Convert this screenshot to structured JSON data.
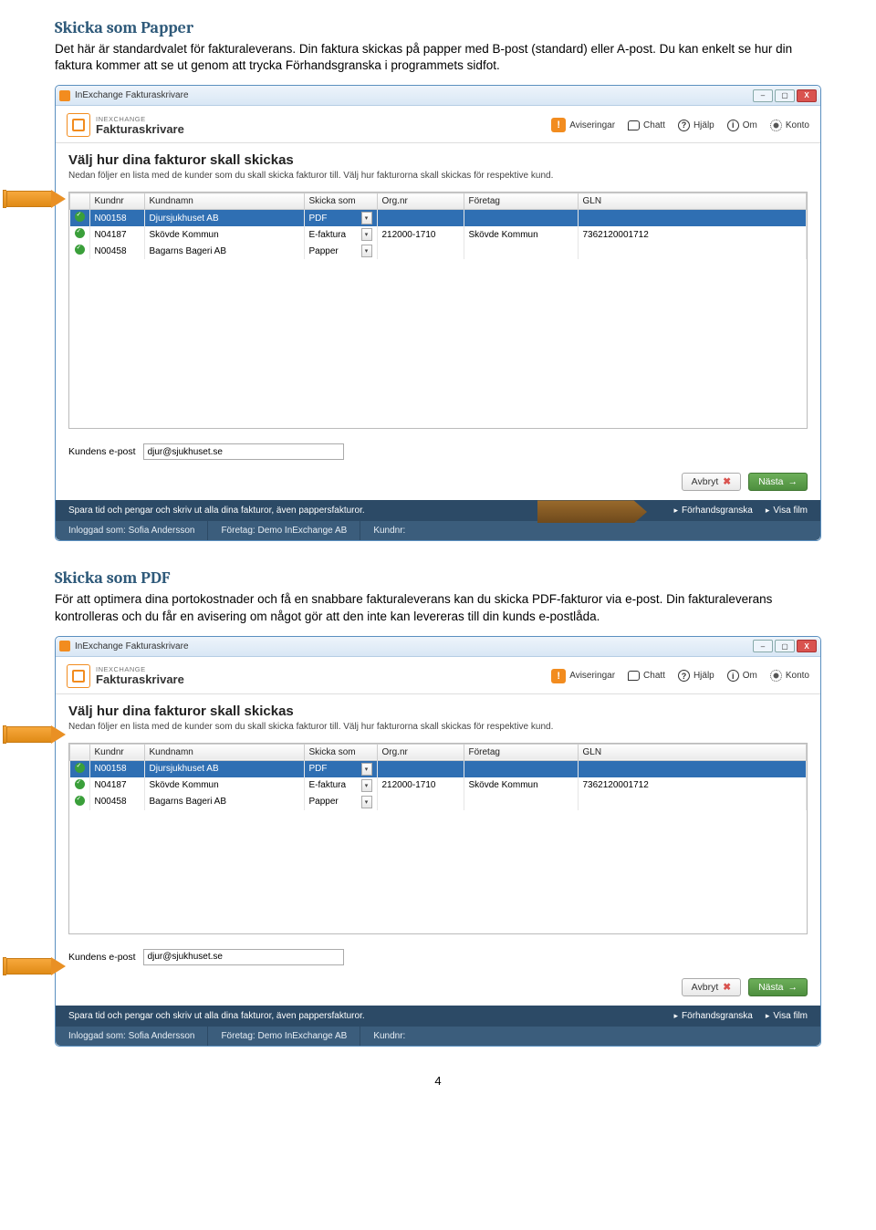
{
  "doc": {
    "page_number": "4",
    "section1": {
      "heading": "Skicka som Papper",
      "text": "Det här är standardvalet för fakturaleverans. Din faktura skickas på papper med B-post (standard) eller A-post. Du kan enkelt se hur din faktura kommer att se ut genom att trycka Förhandsgranska i programmets sidfot."
    },
    "section2": {
      "heading": "Skicka som PDF",
      "text": "För att optimera dina portokostnader och få en snabbare fakturaleverans kan du skicka PDF-fakturor via e-post. Din fakturaleverans kontrolleras och du får en avisering om något gör att den inte kan levereras till din kunds e-postlåda."
    }
  },
  "app": {
    "window_title": "InExchange Fakturaskrivare",
    "brand_small": "INEXCHANGE",
    "brand_big": "Fakturaskrivare",
    "toplinks": {
      "aviseringar": "Aviseringar",
      "chatt": "Chatt",
      "hjalp": "Hjälp",
      "om": "Om",
      "konto": "Konto"
    },
    "page_title": "Välj hur dina fakturor skall skickas",
    "page_sub": "Nedan följer en lista med de kunder som du skall skicka fakturor till. Välj hur fakturorna skall skickas för respektive kund.",
    "columns": {
      "kundnr": "Kundnr",
      "kundnamn": "Kundnamn",
      "skicka": "Skicka som",
      "org": "Org.nr",
      "foretag": "Företag",
      "gln": "GLN"
    },
    "rows": [
      {
        "kundnr": "N00158",
        "kundnamn": "Djursjukhuset AB",
        "skicka": "PDF",
        "org": "",
        "foretag": "",
        "gln": "",
        "selected": true
      },
      {
        "kundnr": "N04187",
        "kundnamn": "Skövde Kommun",
        "skicka": "E-faktura",
        "org": "212000-1710",
        "foretag": "Skövde Kommun",
        "gln": "7362120001712",
        "selected": false
      },
      {
        "kundnr": "N00458",
        "kundnamn": "Bagarns Bageri AB",
        "skicka": "Papper",
        "org": "",
        "foretag": "",
        "gln": "",
        "selected": false
      }
    ],
    "email_label": "Kundens e-post",
    "email_value": "djur@sjukhuset.se",
    "buttons": {
      "cancel": "Avbryt",
      "next": "Nästa"
    },
    "darkbar_text": "Spara tid och pengar och skriv ut alla dina fakturor, även pappersfakturor.",
    "darkbar_links": {
      "forhand": "Förhandsgranska",
      "visa": "Visa film"
    },
    "status": {
      "loggedin_label": "Inloggad som:",
      "loggedin_value": "Sofia Andersson",
      "foretag_label": "Företag:",
      "foretag_value": "Demo InExchange AB",
      "kundnr_label": "Kundnr:"
    }
  }
}
